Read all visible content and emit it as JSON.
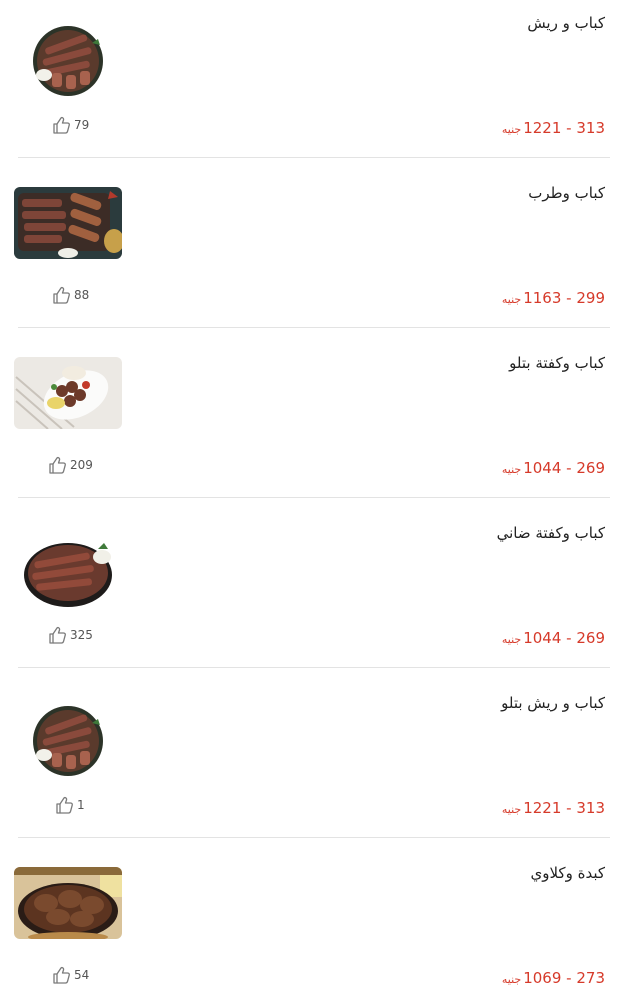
{
  "currency_label": "جنيه",
  "colors": {
    "price": "#d63a2a",
    "name": "#222222",
    "divider": "#e3e3e3"
  },
  "items": [
    {
      "name": "كباب و ريش",
      "price_min": "313",
      "price_max": "1221",
      "likes": "79",
      "image": "round-platter-kebab-ribs"
    },
    {
      "name": "كباب وطرب",
      "price_min": "299",
      "price_max": "1163",
      "likes": "88",
      "image": "dark-tray-kebab-tarb"
    },
    {
      "name": "كباب وكفتة بتلو",
      "price_min": "269",
      "price_max": "1044",
      "likes": "209",
      "image": "white-plate-kebab-kofta"
    },
    {
      "name": "كباب وكفتة ضاني",
      "price_min": "269",
      "price_max": "1044",
      "likes": "325",
      "image": "round-platter-kebab-kofta"
    },
    {
      "name": "كباب و ريش بتلو",
      "price_min": "313",
      "price_max": "1221",
      "likes": "1",
      "image": "round-platter-kebab-ribs"
    },
    {
      "name": "كبدة وكلاوي",
      "price_min": "273",
      "price_max": "1069",
      "likes": "54",
      "image": "skillet-liver-kidney"
    }
  ]
}
